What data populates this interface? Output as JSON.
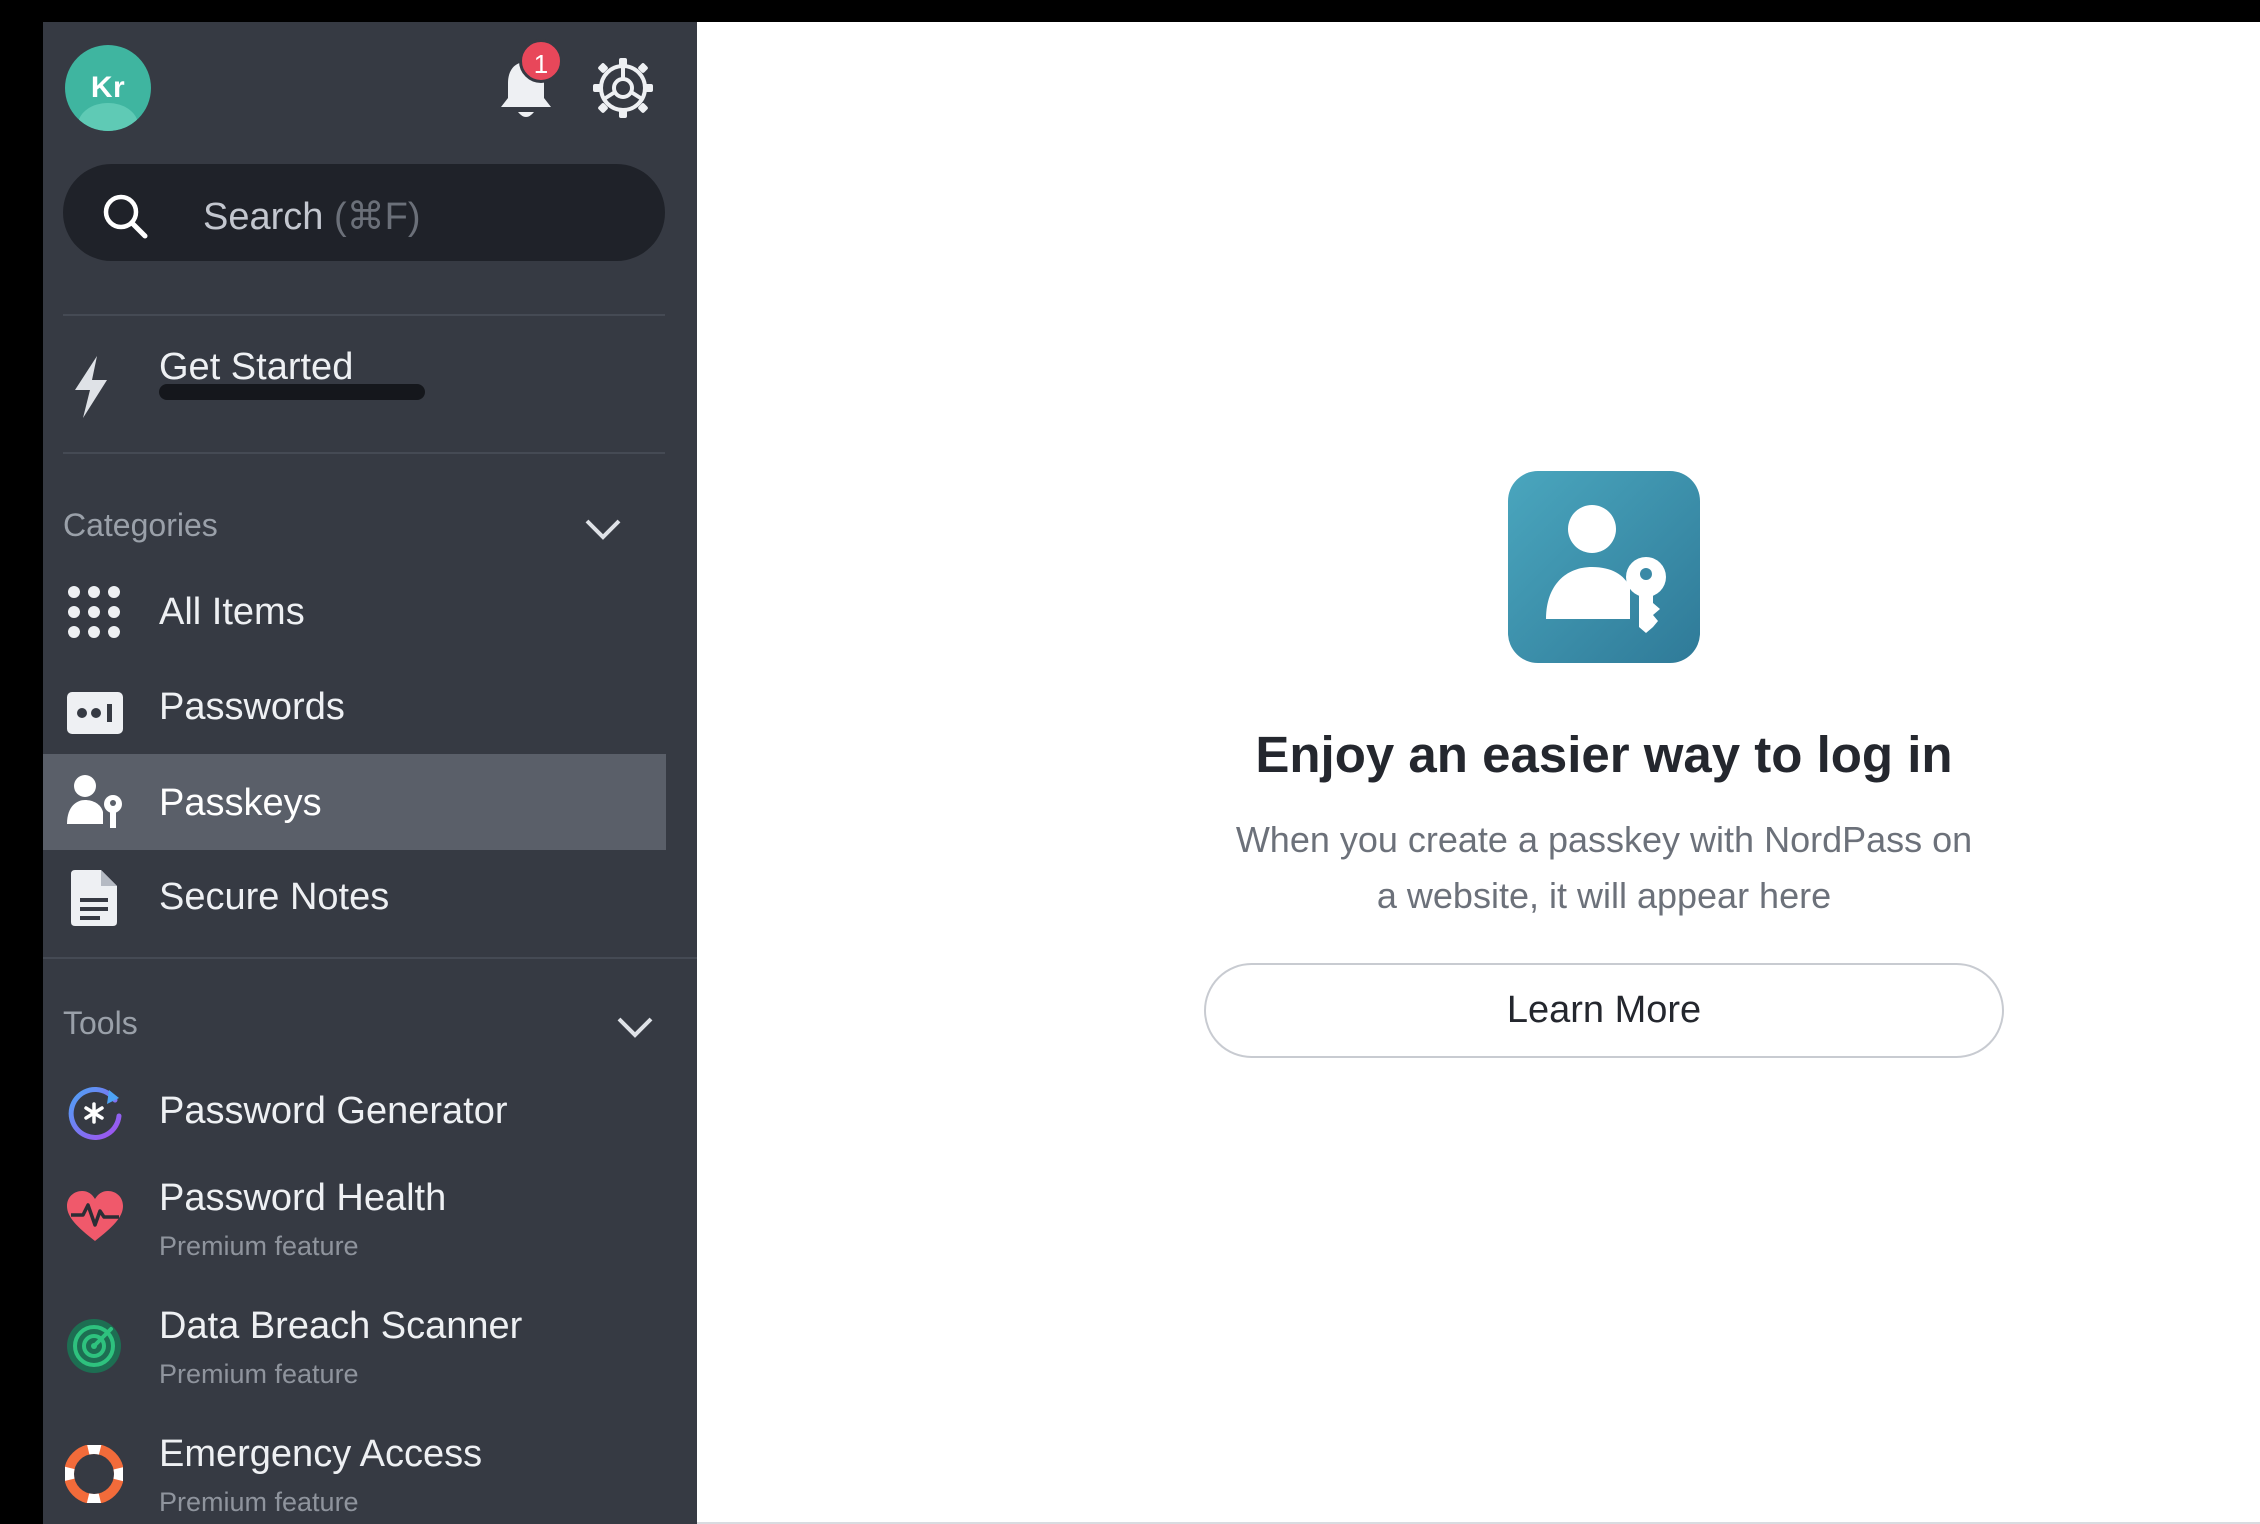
{
  "user": {
    "initials": "Kr"
  },
  "notifications": {
    "count": "1"
  },
  "search": {
    "placeholder": "Search",
    "shortcut": "(⌘F)"
  },
  "get_started": {
    "label": "Get Started",
    "progress": 0.0
  },
  "categories": {
    "title": "Categories",
    "items": [
      {
        "label": "All Items",
        "icon": "grid-icon"
      },
      {
        "label": "Passwords",
        "icon": "password-icon"
      },
      {
        "label": "Passkeys",
        "icon": "passkey-icon",
        "active": true
      },
      {
        "label": "Secure Notes",
        "icon": "note-icon"
      }
    ]
  },
  "tools": {
    "title": "Tools",
    "items": [
      {
        "label": "Password Generator",
        "icon": "password-generator-icon",
        "color": "#7b6cf0"
      },
      {
        "label": "Password Health",
        "sub": "Premium feature",
        "icon": "heart-pulse-icon",
        "color": "#f0596b"
      },
      {
        "label": "Data Breach Scanner",
        "sub": "Premium feature",
        "icon": "radar-icon",
        "color": "#2ec27e"
      },
      {
        "label": "Emergency Access",
        "sub": "Premium feature",
        "icon": "lifebuoy-icon",
        "color": "#f26b3a"
      }
    ]
  },
  "empty_state": {
    "title": "Enjoy an easier way to log in",
    "description_line1": "When you create a passkey with NordPass on",
    "description_line2": "a website, it will appear here",
    "button": "Learn More"
  },
  "colors": {
    "sidebar_bg": "#363a43",
    "active_item_bg": "#5a5f69",
    "badge": "#e8475a",
    "avatar": "#3fb5a0",
    "empty_icon": "#3b8fab"
  }
}
